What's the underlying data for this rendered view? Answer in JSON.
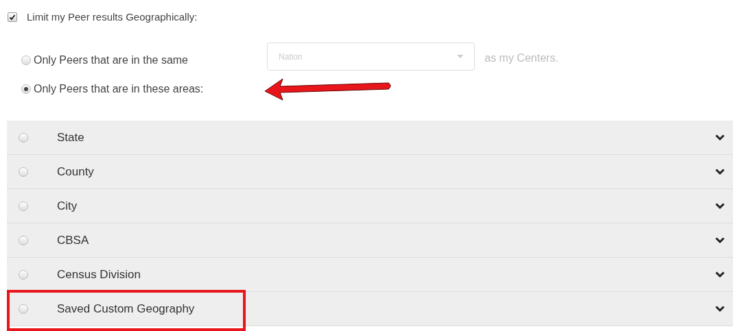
{
  "limit": {
    "label": "Limit my Peer results Geographically:",
    "checked": true
  },
  "options": [
    {
      "kind": "dropdown",
      "label": "Only Peers that are in the same",
      "selected": false,
      "pointed_at": false,
      "dropdown": {
        "placeholder": "Nation",
        "disabled": true
      },
      "suffix": "as my Centers."
    },
    {
      "kind": "plain",
      "label": "Only Peers that are in these areas:",
      "selected": true,
      "pointed_at": true
    }
  ],
  "areas": [
    {
      "label": "State",
      "selected": false,
      "highlighted": false
    },
    {
      "label": "County",
      "selected": false,
      "highlighted": false
    },
    {
      "label": "City",
      "selected": false,
      "highlighted": false
    },
    {
      "label": "CBSA",
      "selected": false,
      "highlighted": false
    },
    {
      "label": "Census Division",
      "selected": false,
      "highlighted": false
    },
    {
      "label": "Saved Custom Geography",
      "selected": false,
      "highlighted": true
    }
  ]
}
